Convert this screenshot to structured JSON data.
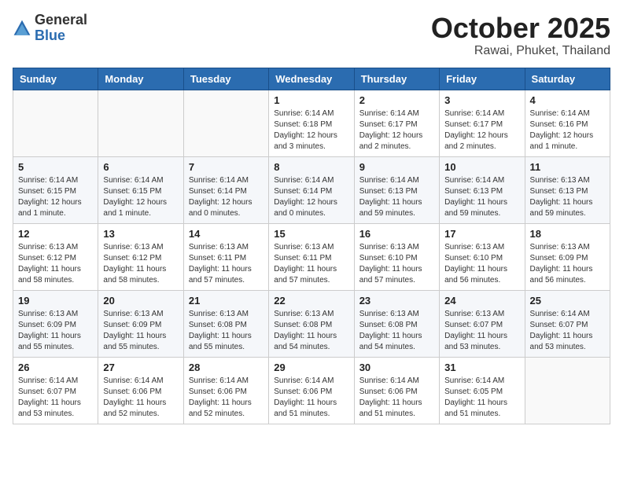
{
  "header": {
    "logo_line1": "General",
    "logo_line2": "Blue",
    "month": "October 2025",
    "location": "Rawai, Phuket, Thailand"
  },
  "weekdays": [
    "Sunday",
    "Monday",
    "Tuesday",
    "Wednesday",
    "Thursday",
    "Friday",
    "Saturday"
  ],
  "weeks": [
    [
      {
        "day": "",
        "info": ""
      },
      {
        "day": "",
        "info": ""
      },
      {
        "day": "",
        "info": ""
      },
      {
        "day": "1",
        "info": "Sunrise: 6:14 AM\nSunset: 6:18 PM\nDaylight: 12 hours and 3 minutes."
      },
      {
        "day": "2",
        "info": "Sunrise: 6:14 AM\nSunset: 6:17 PM\nDaylight: 12 hours and 2 minutes."
      },
      {
        "day": "3",
        "info": "Sunrise: 6:14 AM\nSunset: 6:17 PM\nDaylight: 12 hours and 2 minutes."
      },
      {
        "day": "4",
        "info": "Sunrise: 6:14 AM\nSunset: 6:16 PM\nDaylight: 12 hours and 1 minute."
      }
    ],
    [
      {
        "day": "5",
        "info": "Sunrise: 6:14 AM\nSunset: 6:15 PM\nDaylight: 12 hours and 1 minute."
      },
      {
        "day": "6",
        "info": "Sunrise: 6:14 AM\nSunset: 6:15 PM\nDaylight: 12 hours and 1 minute."
      },
      {
        "day": "7",
        "info": "Sunrise: 6:14 AM\nSunset: 6:14 PM\nDaylight: 12 hours and 0 minutes."
      },
      {
        "day": "8",
        "info": "Sunrise: 6:14 AM\nSunset: 6:14 PM\nDaylight: 12 hours and 0 minutes."
      },
      {
        "day": "9",
        "info": "Sunrise: 6:14 AM\nSunset: 6:13 PM\nDaylight: 11 hours and 59 minutes."
      },
      {
        "day": "10",
        "info": "Sunrise: 6:14 AM\nSunset: 6:13 PM\nDaylight: 11 hours and 59 minutes."
      },
      {
        "day": "11",
        "info": "Sunrise: 6:13 AM\nSunset: 6:13 PM\nDaylight: 11 hours and 59 minutes."
      }
    ],
    [
      {
        "day": "12",
        "info": "Sunrise: 6:13 AM\nSunset: 6:12 PM\nDaylight: 11 hours and 58 minutes."
      },
      {
        "day": "13",
        "info": "Sunrise: 6:13 AM\nSunset: 6:12 PM\nDaylight: 11 hours and 58 minutes."
      },
      {
        "day": "14",
        "info": "Sunrise: 6:13 AM\nSunset: 6:11 PM\nDaylight: 11 hours and 57 minutes."
      },
      {
        "day": "15",
        "info": "Sunrise: 6:13 AM\nSunset: 6:11 PM\nDaylight: 11 hours and 57 minutes."
      },
      {
        "day": "16",
        "info": "Sunrise: 6:13 AM\nSunset: 6:10 PM\nDaylight: 11 hours and 57 minutes."
      },
      {
        "day": "17",
        "info": "Sunrise: 6:13 AM\nSunset: 6:10 PM\nDaylight: 11 hours and 56 minutes."
      },
      {
        "day": "18",
        "info": "Sunrise: 6:13 AM\nSunset: 6:09 PM\nDaylight: 11 hours and 56 minutes."
      }
    ],
    [
      {
        "day": "19",
        "info": "Sunrise: 6:13 AM\nSunset: 6:09 PM\nDaylight: 11 hours and 55 minutes."
      },
      {
        "day": "20",
        "info": "Sunrise: 6:13 AM\nSunset: 6:09 PM\nDaylight: 11 hours and 55 minutes."
      },
      {
        "day": "21",
        "info": "Sunrise: 6:13 AM\nSunset: 6:08 PM\nDaylight: 11 hours and 55 minutes."
      },
      {
        "day": "22",
        "info": "Sunrise: 6:13 AM\nSunset: 6:08 PM\nDaylight: 11 hours and 54 minutes."
      },
      {
        "day": "23",
        "info": "Sunrise: 6:13 AM\nSunset: 6:08 PM\nDaylight: 11 hours and 54 minutes."
      },
      {
        "day": "24",
        "info": "Sunrise: 6:13 AM\nSunset: 6:07 PM\nDaylight: 11 hours and 53 minutes."
      },
      {
        "day": "25",
        "info": "Sunrise: 6:14 AM\nSunset: 6:07 PM\nDaylight: 11 hours and 53 minutes."
      }
    ],
    [
      {
        "day": "26",
        "info": "Sunrise: 6:14 AM\nSunset: 6:07 PM\nDaylight: 11 hours and 53 minutes."
      },
      {
        "day": "27",
        "info": "Sunrise: 6:14 AM\nSunset: 6:06 PM\nDaylight: 11 hours and 52 minutes."
      },
      {
        "day": "28",
        "info": "Sunrise: 6:14 AM\nSunset: 6:06 PM\nDaylight: 11 hours and 52 minutes."
      },
      {
        "day": "29",
        "info": "Sunrise: 6:14 AM\nSunset: 6:06 PM\nDaylight: 11 hours and 51 minutes."
      },
      {
        "day": "30",
        "info": "Sunrise: 6:14 AM\nSunset: 6:06 PM\nDaylight: 11 hours and 51 minutes."
      },
      {
        "day": "31",
        "info": "Sunrise: 6:14 AM\nSunset: 6:05 PM\nDaylight: 11 hours and 51 minutes."
      },
      {
        "day": "",
        "info": ""
      }
    ]
  ]
}
